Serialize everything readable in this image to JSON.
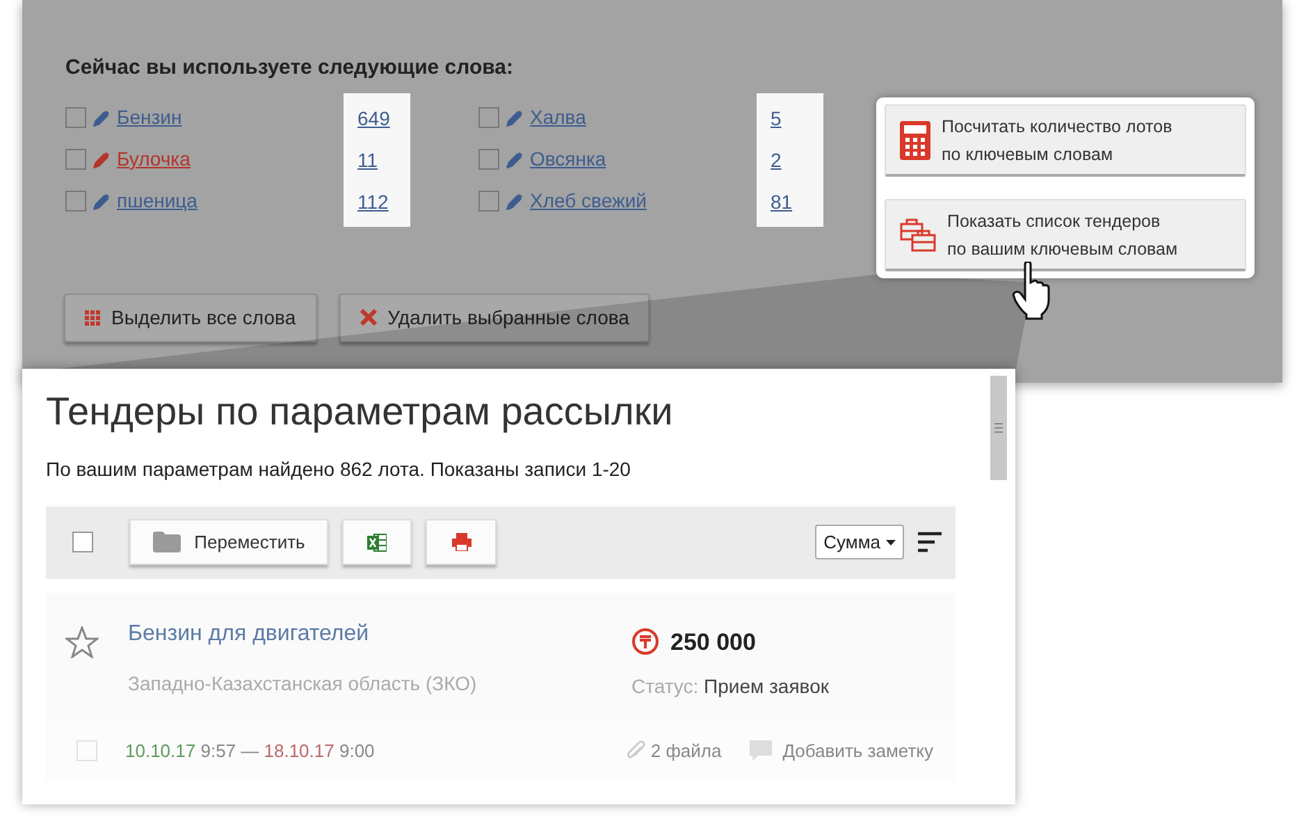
{
  "words_panel": {
    "heading": "Сейчас вы используете следующие слова:",
    "columns": [
      {
        "words": [
          {
            "label": "Бензин",
            "count": "649",
            "color": "#3d5d8f",
            "checked": false
          },
          {
            "label": "Булочка",
            "count": "11",
            "color": "#b4352a",
            "checked": false
          },
          {
            "label": "пшеница",
            "count": "112",
            "color": "#3d5d8f",
            "checked": false
          }
        ]
      },
      {
        "words": [
          {
            "label": "Халва",
            "count": "5",
            "color": "#3d5d8f",
            "checked": false
          },
          {
            "label": "Овсянка",
            "count": "2",
            "color": "#3d5d8f",
            "checked": false
          },
          {
            "label": "Хлеб свежий",
            "count": "81",
            "color": "#3d5d8f",
            "checked": false
          }
        ]
      }
    ],
    "buttons": [
      {
        "label": "Выделить все слова"
      },
      {
        "label": "Удалить выбранные слова"
      }
    ]
  },
  "actions_popup": {
    "buttons": [
      {
        "label": "Посчитать количество лотов\nпо ключевым словам"
      },
      {
        "label": "Показать список тендеров\nпо вашим ключевым словам"
      }
    ]
  },
  "results": {
    "title": "Тендеры по параметрам рассылки",
    "summary": "По вашим параметрам найдено 862 лота. Показаны записи 1-20",
    "toolbar": {
      "checked": false,
      "move_label": "Переместить",
      "sort_select": "Сумма"
    },
    "tender": {
      "starred": false,
      "title": "Бензин для двигателей",
      "region": "Западно-Казахстанская область (ЗКО)",
      "amount": "250 000",
      "status_label": "Статус:",
      "status": "Прием заявок",
      "checked": false,
      "start_date": "10.10.17",
      "start_time": "9:57",
      "separator": "—",
      "end_date": "18.10.17",
      "end_time": "9:00",
      "files": "2 файла",
      "note": "Добавить заметку"
    }
  }
}
